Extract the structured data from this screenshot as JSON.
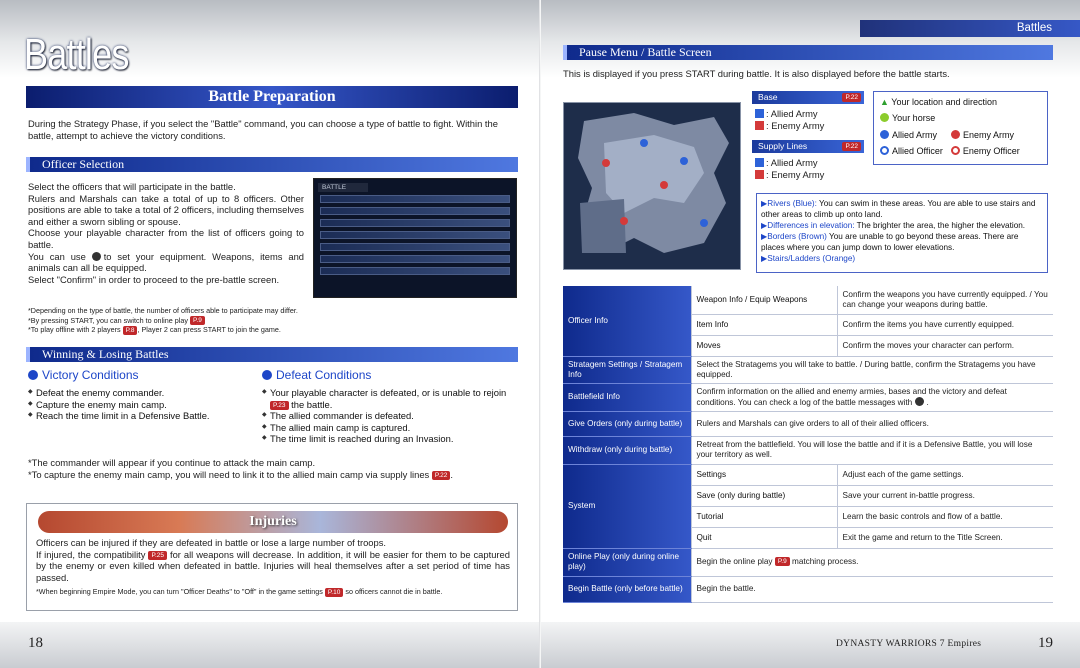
{
  "header": {
    "big_title": "Battles",
    "section_tab": "Battles"
  },
  "left": {
    "banner": "Battle Preparation",
    "intro": "During the Strategy Phase, if you select the \"Battle\" command, you can choose a type of battle to fight. Within the battle, attempt to achieve the victory conditions.",
    "officer_heading": "Officer Selection",
    "officer_p1": "Select the officers that will participate in the battle.",
    "officer_p2": "Rulers and Marshals can take a total of up to 8 officers. Other positions are able to take a total of 2 officers, including themselves and either a sworn sibling or spouse.",
    "officer_p3": "Choose your playable character from the list of officers going to battle.",
    "officer_p4a": "You can use",
    "officer_p4b": "to set your equipment. Weapons, items and animals can all be equipped.",
    "officer_p5": "Select \"Confirm\" in order to proceed to the pre-battle screen.",
    "note1": "*Depending on the type of battle, the number of officers able to participate may differ.",
    "note2a": "*By pressing START, you can switch to online play",
    "note2_ref": "P.9",
    "note3a": "*To play offline with 2 players",
    "note3_ref": "P.8",
    "note3b": ", Player 2 can press START to join the game.",
    "screenshot_title": "BATTLE",
    "winlose_heading": "Winning & Losing Battles",
    "victory_title": "Victory Conditions",
    "victory": [
      "Defeat the enemy commander.",
      "Capture the enemy main camp.",
      "Reach the time limit in a Defensive Battle."
    ],
    "defeat_title": "Defeat Conditions",
    "defeat_1a": "Your playable character is defeated, or is unable to rejoin",
    "defeat_1_ref": "P.23",
    "defeat_1b": "the battle.",
    "defeat": [
      "The allied commander is defeated.",
      "The allied main camp is captured.",
      "The time limit is reached during an Invasion."
    ],
    "cmd_note": "*The commander will appear if you continue to attack the main camp.",
    "capture_note_a": "*To capture the enemy main camp, you will need to link it to the allied main camp via supply lines",
    "capture_note_ref": "P.22",
    "injuries_title": "Injuries",
    "inj_p1": "Officers can be injured if they are defeated in battle or lose a large number of troops.",
    "inj_p2a": "If injured, the compatibility",
    "inj_p2_ref": "P.25",
    "inj_p2b": "for all weapons will decrease. In addition, it will be easier for them to be captured by the enemy or even killed when defeated in battle. Injuries will heal themselves after a set period of time has passed.",
    "inj_note_a": "*When beginning Empire Mode, you can turn \"Officer Deaths\" to \"Off\" in the game settings",
    "inj_note_ref": "P.10",
    "inj_note_b": "so officers cannot die in battle.",
    "page_number": "18"
  },
  "right": {
    "pause_heading": "Pause Menu / Battle Screen",
    "pause_intro": "This is displayed if you press START during battle. It is also displayed before the battle starts.",
    "base_label": "Base",
    "base_ref": "P.22",
    "allied_army": "Allied Army",
    "enemy_army": "Enemy Army",
    "supply_label": "Supply Lines",
    "supply_ref": "P.22",
    "legend_location": "Your location and direction",
    "legend_horse": "Your horse",
    "legend_allied_army": "Allied Army",
    "legend_enemy_army": "Enemy Army",
    "legend_allied_officer": "Allied Officer",
    "legend_enemy_officer": "Enemy Officer",
    "rivers_label": "Rivers (Blue):",
    "rivers_text": "You can swim in these areas. You are able to use stairs and other areas to climb up onto land.",
    "elev_label": "Differences in elevation:",
    "elev_text": "The brighter the area, the higher the elevation.",
    "borders_label": "Borders (Brown)",
    "borders_text": "You are unable to go beyond these areas. There are places where you can jump down to lower elevations.",
    "stairs_label": "Stairs/Ladders (Orange)",
    "rows": [
      {
        "label": "Officer Info",
        "mid": "Weapon Info / Equip Weapons",
        "desc": "Confirm the weapons you have currently equipped. / You can change your weapons during battle."
      },
      {
        "label": "",
        "mid": "Item Info",
        "desc": "Confirm the items you have currently equipped."
      },
      {
        "label": "",
        "mid": "Moves",
        "desc": "Confirm the moves your character can perform."
      },
      {
        "label": "Stratagem Settings / Stratagem Info",
        "mid": "",
        "desc": "Select the Stratagems you will take to battle. / During battle, confirm the Stratagems you have equipped."
      },
      {
        "label": "Battlefield Info",
        "mid": "",
        "desc": "Confirm information on the allied and enemy armies, bases and the victory and defeat conditions. You can check a log of the battle messages with"
      },
      {
        "label": "Give Orders (only during battle)",
        "mid": "",
        "desc": "Rulers and Marshals can give orders to all of their allied officers."
      },
      {
        "label": "Withdraw (only during battle)",
        "mid": "",
        "desc": "Retreat from the battlefield. You will lose the battle and if it is a Defensive Battle, you will lose your territory as well."
      },
      {
        "label": "System",
        "mid": "Settings",
        "desc": "Adjust each of the game settings."
      },
      {
        "label": "",
        "mid": "Save (only during battle)",
        "desc": "Save your current in-battle progress."
      },
      {
        "label": "",
        "mid": "Tutorial",
        "desc": "Learn the basic controls and flow of a battle."
      },
      {
        "label": "",
        "mid": "Quit",
        "desc": "Exit the game and return to the Title Screen."
      },
      {
        "label": "Online Play (only during online play)",
        "mid": "",
        "desc": "Begin the online play"
      },
      {
        "label": "Begin Battle (only before battle)",
        "mid": "",
        "desc": "Begin the battle."
      }
    ],
    "online_ref": "P.9",
    "online_desc_b": "matching process.",
    "footer": "DYNASTY WARRIORS 7 Empires",
    "page_number": "19"
  },
  "colors": {
    "accent_blue": "#1d46c8",
    "ref_red": "#c0282a",
    "banner_navy": "#0f2a8c"
  }
}
